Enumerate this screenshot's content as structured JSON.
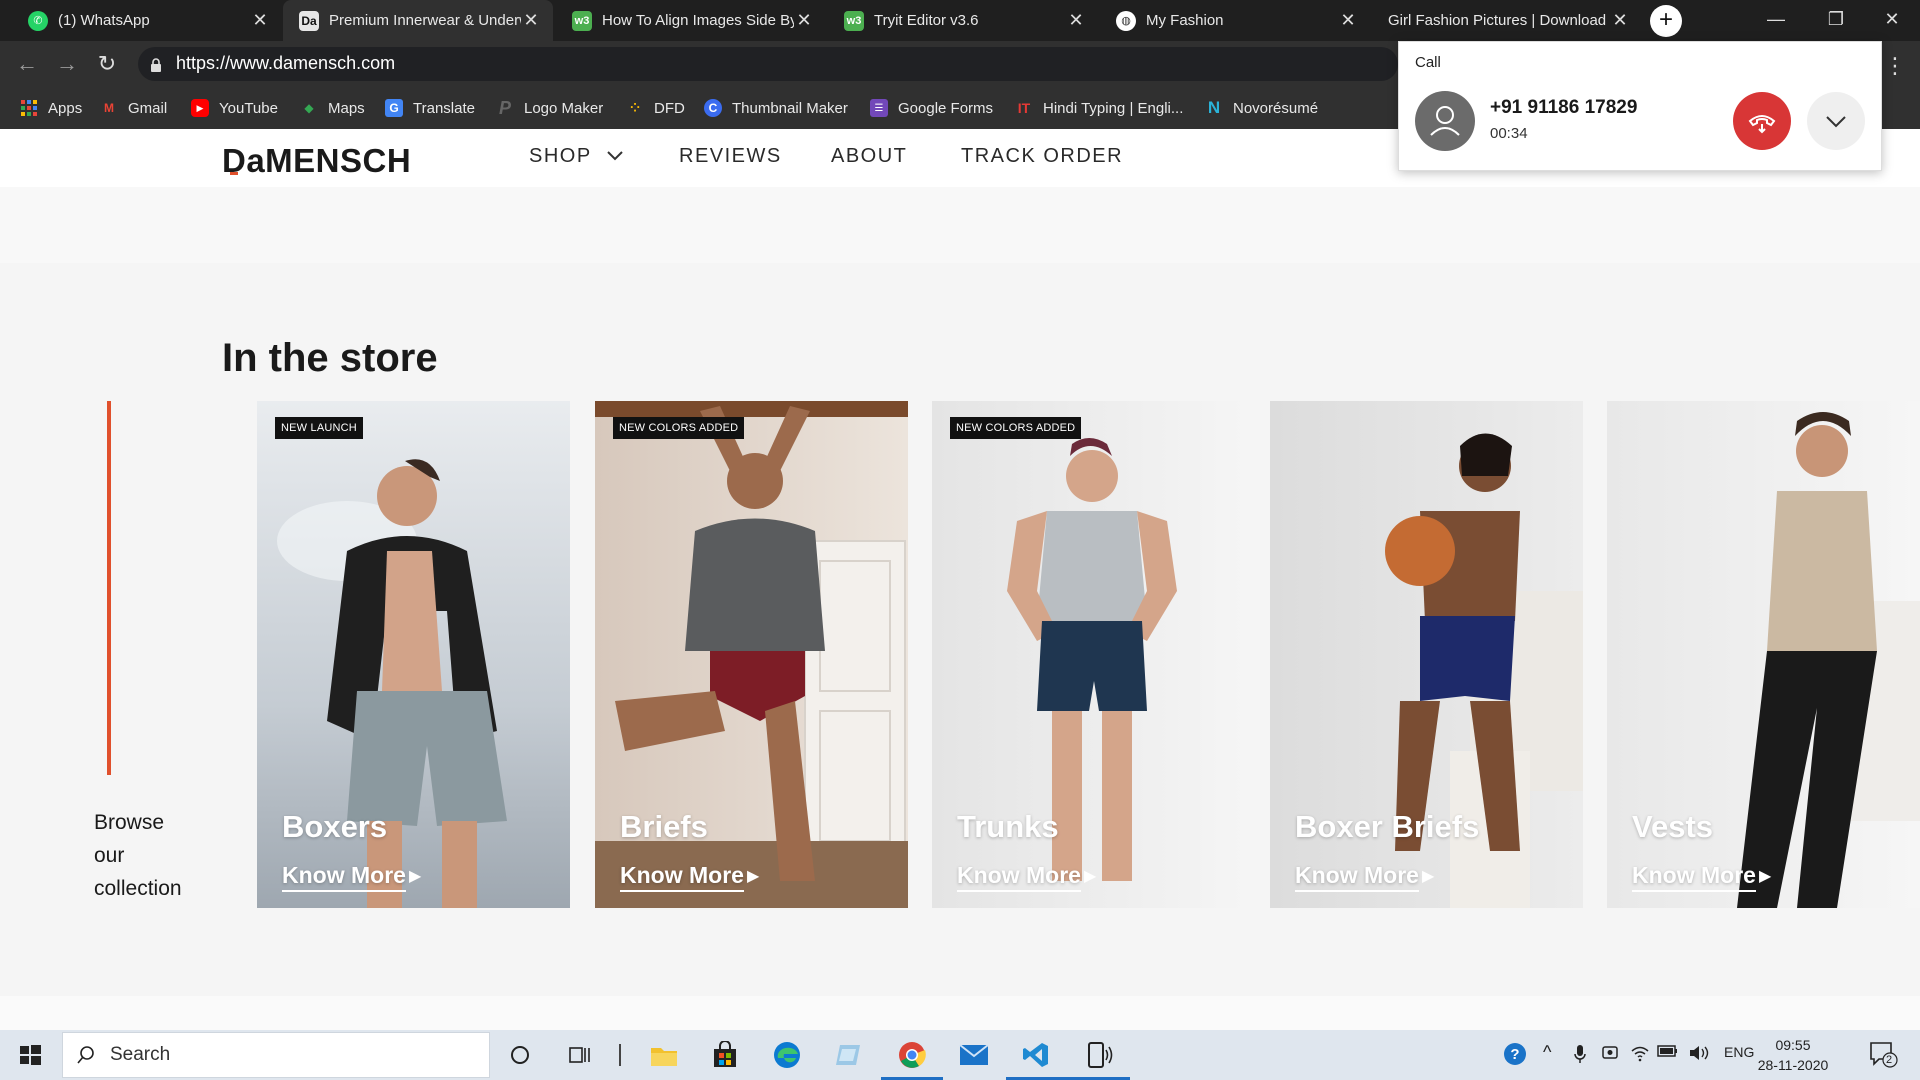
{
  "browser": {
    "tabs": [
      {
        "title": "(1) WhatsApp",
        "icon": "whatsapp-icon",
        "color": "#25d366"
      },
      {
        "title": "Premium Innerwear & Underwear",
        "icon": "damensch-icon",
        "color": "#1a1a1a"
      },
      {
        "title": "How To Align Images Side By Side",
        "icon": "tryit-icon",
        "color": "#4caf50"
      },
      {
        "title": "Tryit Editor v3.6",
        "icon": "tryit-icon",
        "color": "#4caf50"
      },
      {
        "title": "My Fashion",
        "icon": "globe-icon",
        "color": "#ffffff"
      },
      {
        "title": "Girl Fashion Pictures | Download",
        "icon": "page-icon",
        "color": "#ffffff"
      }
    ],
    "url": "https://www.damensch.com",
    "bookmarks": [
      {
        "label": "Apps",
        "icon": "apps-grid-icon"
      },
      {
        "label": "Gmail",
        "icon": "gmail-icon"
      },
      {
        "label": "YouTube",
        "icon": "youtube-icon"
      },
      {
        "label": "Maps",
        "icon": "maps-icon"
      },
      {
        "label": "Translate",
        "icon": "translate-icon"
      },
      {
        "label": "Logo Maker",
        "icon": "logo-maker-icon"
      },
      {
        "label": "DFD",
        "icon": "dfd-icon"
      },
      {
        "label": "Thumbnail Maker",
        "icon": "thumbnail-maker-icon"
      },
      {
        "label": "Google Forms",
        "icon": "google-forms-icon"
      },
      {
        "label": "Hindi Typing | Engli...",
        "icon": "hindi-typing-icon"
      },
      {
        "label": "Novorésumé",
        "icon": "novoresume-icon"
      }
    ]
  },
  "site": {
    "logo": "DaMENSCH",
    "nav": [
      "SHOP",
      "REVIEWS",
      "ABOUT",
      "TRACK ORDER"
    ],
    "section_title": "In the store",
    "browse_text": [
      "Browse",
      "our",
      "collection"
    ],
    "accent_color": "#e0502c",
    "cards": [
      {
        "name": "Boxers",
        "badge": "NEW LAUNCH",
        "cta": "Know More"
      },
      {
        "name": "Briefs",
        "badge": "NEW COLORS ADDED",
        "cta": "Know More"
      },
      {
        "name": "Trunks",
        "badge": "NEW COLORS ADDED",
        "cta": "Know More"
      },
      {
        "name": "Boxer Briefs",
        "badge": "",
        "cta": "Know More"
      },
      {
        "name": "Vests",
        "badge": "",
        "cta": "Know More"
      }
    ]
  },
  "call": {
    "title": "Call",
    "number": "+91 91186 17829",
    "duration": "00:34"
  },
  "taskbar": {
    "search_placeholder": "Search",
    "language": "ENG",
    "time": "09:55",
    "date": "28-11-2020",
    "notifications": "2"
  }
}
